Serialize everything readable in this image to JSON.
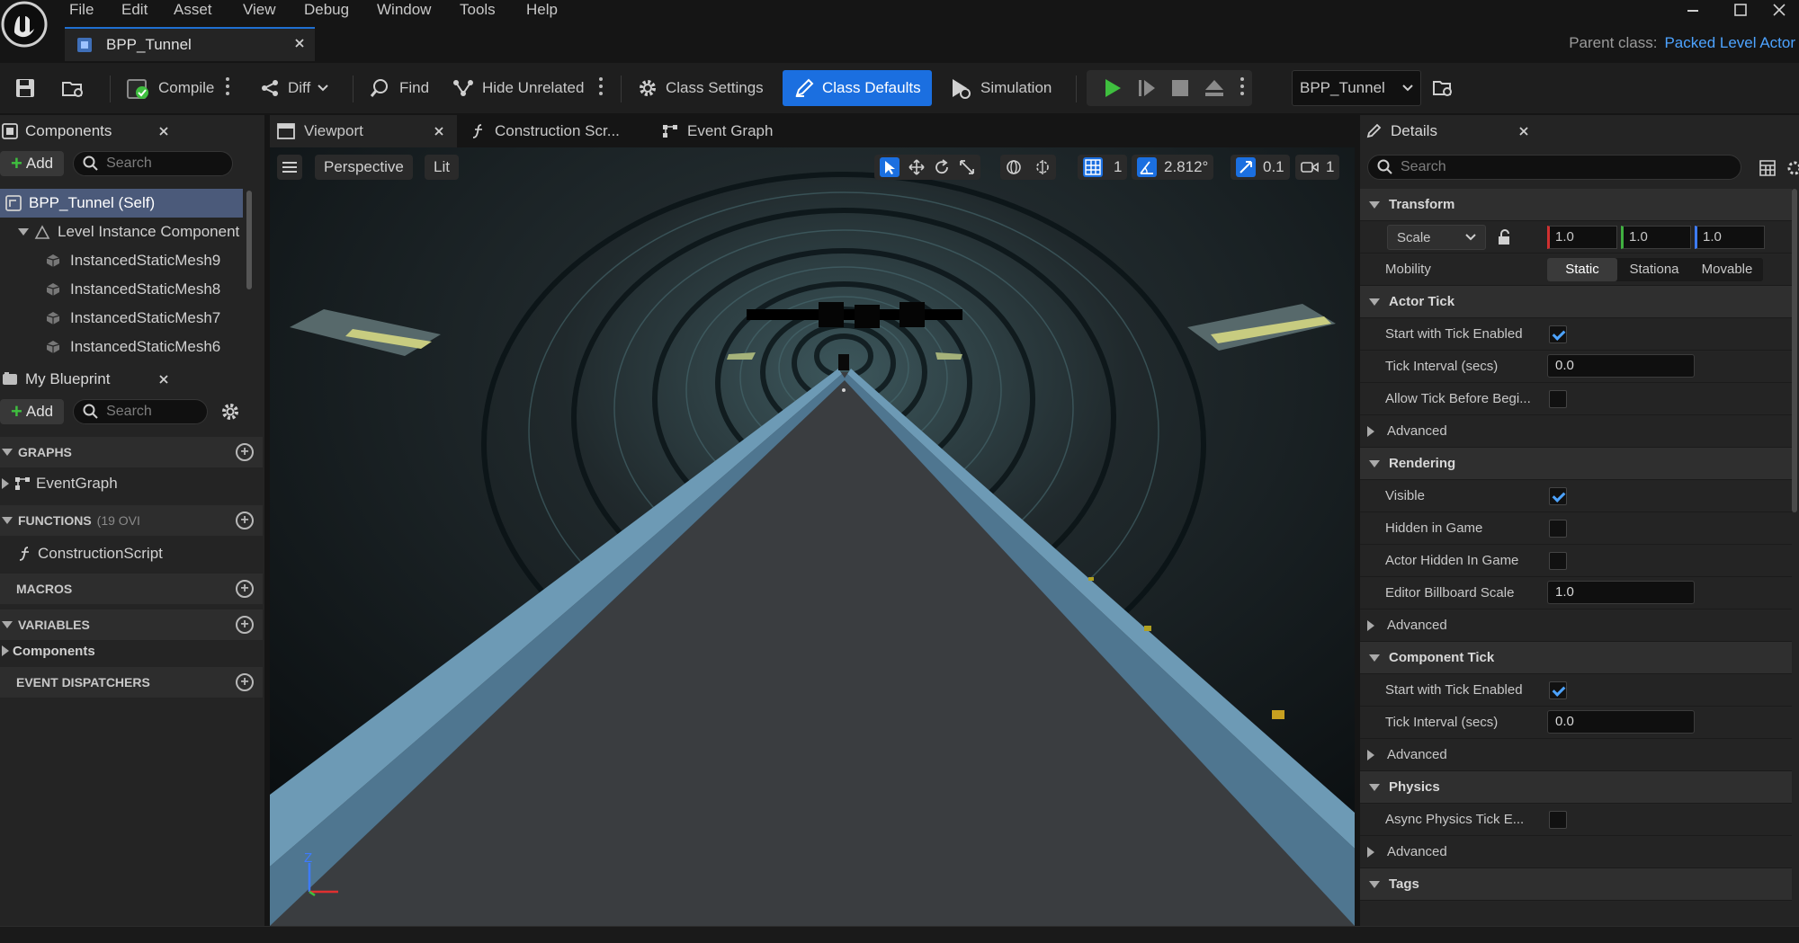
{
  "menu": [
    "File",
    "Edit",
    "Asset",
    "View",
    "Debug",
    "Window",
    "Tools",
    "Help"
  ],
  "document_tab": {
    "title": "BPP_Tunnel"
  },
  "parent_class": {
    "label": "Parent class:",
    "value": "Packed Level Actor"
  },
  "toolbar": {
    "compile": "Compile",
    "diff": "Diff",
    "find": "Find",
    "hide_unrelated": "Hide Unrelated",
    "class_settings": "Class Settings",
    "class_defaults": "Class Defaults",
    "simulation": "Simulation",
    "debug_object": "BPP_Tunnel"
  },
  "components_panel": {
    "title": "Components",
    "add": "Add",
    "search_placeholder": "Search",
    "items": [
      {
        "label": "BPP_Tunnel (Self)",
        "selected": true
      },
      {
        "label": "Level Instance Component"
      },
      {
        "label": "InstancedStaticMesh9"
      },
      {
        "label": "InstancedStaticMesh8"
      },
      {
        "label": "InstancedStaticMesh7"
      },
      {
        "label": "InstancedStaticMesh6"
      }
    ]
  },
  "blueprint_panel": {
    "title": "My Blueprint",
    "add": "Add",
    "search_placeholder": "Search",
    "sections": {
      "graphs": "GRAPHS",
      "event_graph": "EventGraph",
      "functions": "FUNCTIONS",
      "functions_count": "(19 OVI",
      "construction_script": "ConstructionScript",
      "macros": "MACROS",
      "variables": "VARIABLES",
      "components": "Components",
      "event_dispatchers": "EVENT DISPATCHERS"
    }
  },
  "editor_tabs": [
    {
      "label": "Viewport",
      "active": true
    },
    {
      "label": "Construction Scr..."
    },
    {
      "label": "Event Graph"
    }
  ],
  "viewport": {
    "perspective": "Perspective",
    "lit": "Lit",
    "grid_snap": "1",
    "rotation_snap": "2.812°",
    "scale_snap": "0.1",
    "camera_speed": "1",
    "axis_z": "Z"
  },
  "details": {
    "title": "Details",
    "search_placeholder": "Search",
    "transform": {
      "section": "Transform",
      "scale_mode": "Scale",
      "scale_x": "1.0",
      "scale_y": "1.0",
      "scale_z": "1.0",
      "mobility_label": "Mobility",
      "mobility_options": [
        "Static",
        "Stationa",
        "Movable"
      ],
      "mobility_selected": "Static"
    },
    "actor_tick": {
      "section": "Actor Tick",
      "start_tick": "Start with Tick Enabled",
      "tick_interval": "Tick Interval (secs)",
      "tick_interval_value": "0.0",
      "allow_tick": "Allow Tick Before Begi...",
      "advanced": "Advanced"
    },
    "rendering": {
      "section": "Rendering",
      "visible": "Visible",
      "hidden_in_game": "Hidden in Game",
      "actor_hidden": "Actor Hidden In Game",
      "billboard_scale": "Editor Billboard Scale",
      "billboard_scale_value": "1.0",
      "advanced": "Advanced"
    },
    "component_tick": {
      "section": "Component Tick",
      "start_tick": "Start with Tick Enabled",
      "tick_interval": "Tick Interval (secs)",
      "tick_interval_value": "0.0",
      "advanced": "Advanced"
    },
    "physics": {
      "section": "Physics",
      "async_tick": "Async Physics Tick E...",
      "advanced": "Advanced"
    },
    "tags": {
      "section": "Tags"
    }
  },
  "colors": {
    "accent": "#1f6fd1",
    "active_button": "#1b6fe0",
    "play_green": "#3fbf3f",
    "link_blue": "#4da3ff"
  }
}
